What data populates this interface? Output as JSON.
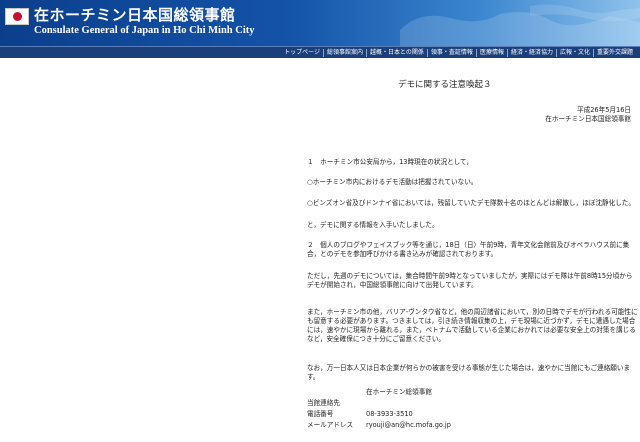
{
  "header": {
    "title_jp": "在ホーチミン日本国総領事館",
    "title_en": "Consulate General of Japan in Ho Chi Minh City"
  },
  "nav": [
    "トップページ",
    "総領事館案内",
    "越概・日本との関係",
    "領事・査証情報",
    "医療情報",
    "経済・経済協力",
    "広報・文化",
    "重要外交課題"
  ],
  "notice": {
    "title": "デモに関する注意喚起３",
    "date": "平成26年5月16日",
    "issuer": "在ホーチミン日本国総領事館",
    "p1": "１　ホーチミン市公安局から，13時現在の状況として，",
    "p2": "○ホーチミン市内におけるデモ活動は把握されていない。",
    "p3": "○ビンズオン省及びドンナイ省においては，残留していたデモ隊数十名のほとんどは解散し，ほぼ沈静化した。",
    "p4": "と，デモに関する情報を入手いたしました。",
    "p5": "２　個人のブログやフェイスブック等を通じ，18日（日）午前9時，青年文化会館前及びオペラハウス前に集合，とのデモを参加呼びかける書き込みが確認されております。",
    "p6": "ただし，先週のデモについては，集合時間午前9時となっていましたが，実際にはデモ隊は午前8時15分頃からデモが開始され，中国総領事館に向けて出発しています。",
    "p7": "また，ホーチミン市の他，バリア-ヴンタウ省など，他の周辺諸省において，別の日時でデモが行われる可能性にも留意する必要があります。つきましては，引き続き情報収集の上，デモ現場に近づかず，デモに遭遇した場合には，速やかに現場から離れる，また，ベトナムで活動している企業におかれては必要な安全上の対策を講じるなど，安全確保につき十分にご留意ください。",
    "p8": "なお，万一日本人又は日本企業が何らかの被害を受ける事態が生じた場合は，速やかに当館にもご連絡願います。"
  },
  "contact": {
    "org": "在ホーチミン総領事館",
    "dept": "当館連絡先",
    "phone_label": "電話番号",
    "phone": "08-3933-3510",
    "mail_label": "メールアドレス",
    "mail": "ryouji@an@hc.mofa.go.jp"
  },
  "colors": {
    "header_dark": "#0b3f8c",
    "header_light": "#8fc2ec",
    "nav_bg": "#1b3f7a",
    "flag_red": "#c8102e"
  }
}
